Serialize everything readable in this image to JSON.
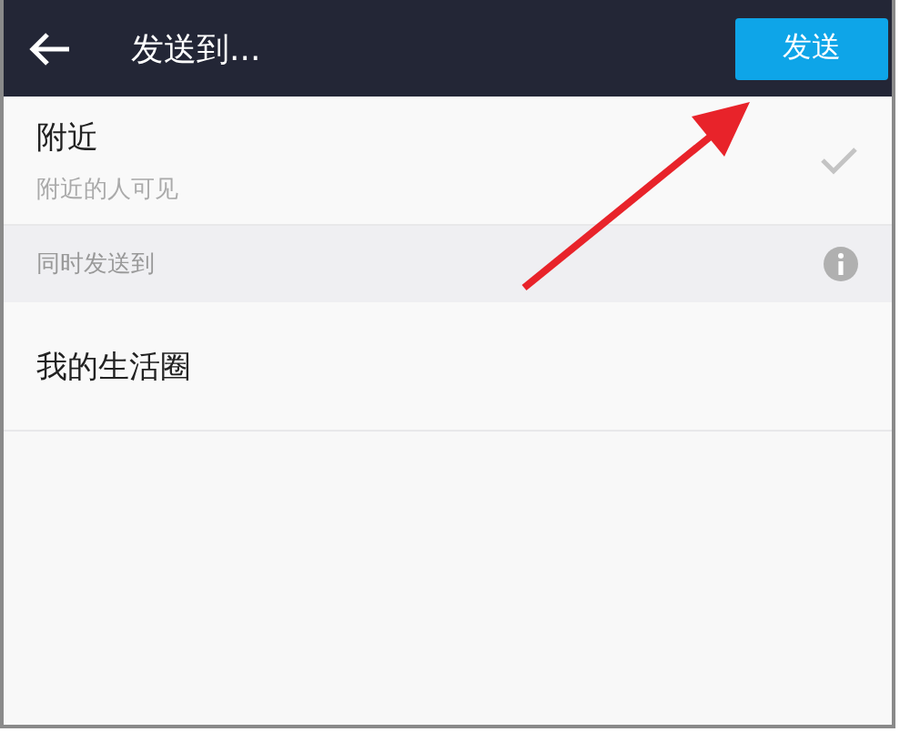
{
  "header": {
    "title": "发送到...",
    "action": "发送"
  },
  "targets": [
    {
      "title": "附近",
      "subtitle": "附近的人可见",
      "selected": true
    }
  ],
  "section": {
    "title": "同时发送到"
  },
  "also": [
    {
      "title": "我的生活圈",
      "selected": false
    }
  ]
}
